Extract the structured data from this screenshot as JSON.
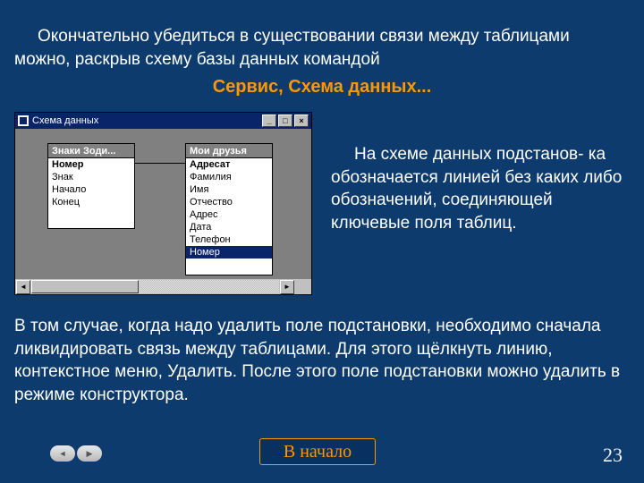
{
  "para1": "Окончательно убедиться в существовании связи между таблицами можно, раскрыв схему базы данных командой",
  "highlight": "Сервис, Схема данных...",
  "shot": {
    "title": "Схема данных",
    "minimize": "_",
    "maximize": "□",
    "close": "×",
    "t1": {
      "title": "Знаки Зоди...",
      "rows": [
        "Номер",
        "Знак",
        "Начало",
        "Конец"
      ],
      "bold": 0
    },
    "t2": {
      "title": "Мои друзья",
      "rows": [
        "Адресат",
        "Фамилия",
        "Имя",
        "Отчество",
        "Адрес",
        "Дата",
        "Телефон",
        "Номер"
      ],
      "bold": 0,
      "sel": 7
    },
    "scrollLeft": "◄",
    "scrollRight": "►"
  },
  "para2": "На схеме данных подстанов- ка обозначается линией без каких либо обозначений, соединяющей ключевые поля таблиц.",
  "para3": "В том случае, когда надо удалить поле подстановки, необходимо сначала ликвидировать связь между таблицами. Для этого щёлкнуть линию, контекстное меню, Удалить. После этого поле подстановки можно удалить в режиме конструктора.",
  "nav": {
    "prev": "◄",
    "next": "▶"
  },
  "start": "В начало",
  "page": "23"
}
